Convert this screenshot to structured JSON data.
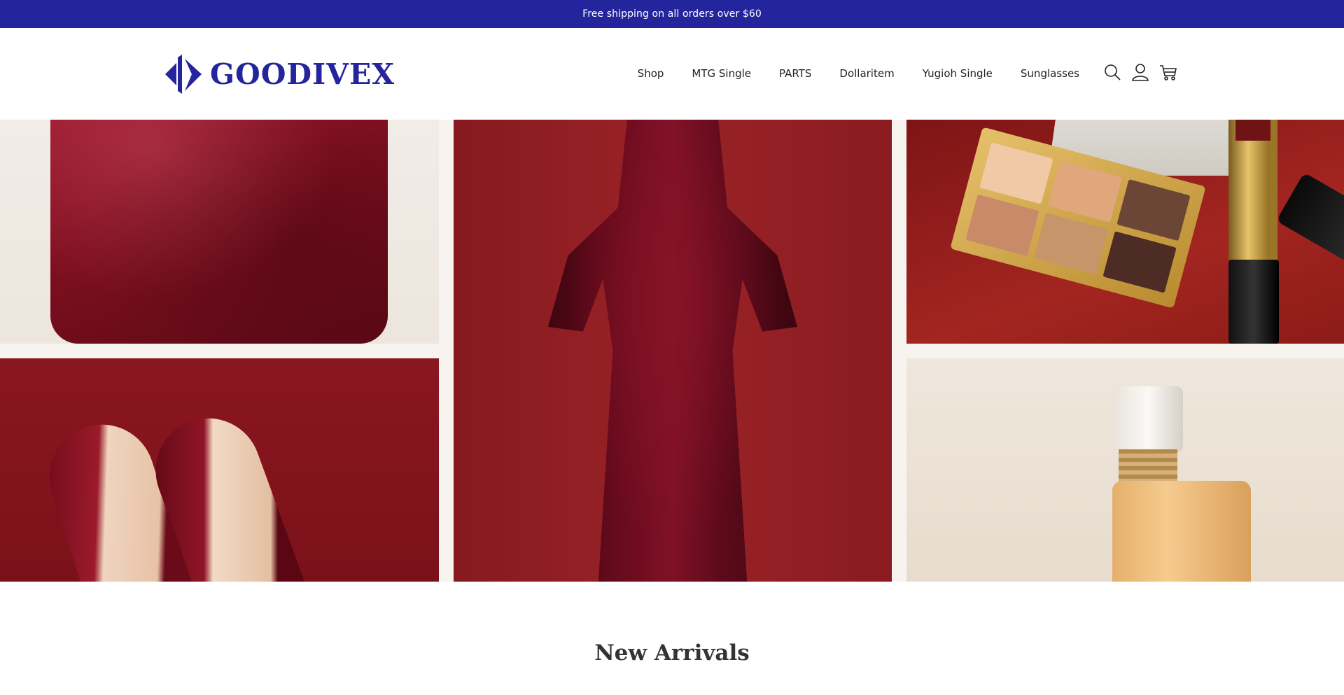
{
  "announcement": {
    "text": "Free shipping on all orders over $60"
  },
  "brand": {
    "name": "GOODIVEX",
    "color": "#24249c"
  },
  "nav": {
    "items": [
      {
        "label": "Shop"
      },
      {
        "label": "MTG Single"
      },
      {
        "label": "PARTS"
      },
      {
        "label": "Dollaritem"
      },
      {
        "label": "Yugioh Single"
      },
      {
        "label": "Sunglasses"
      }
    ]
  },
  "header_icons": [
    "search-icon",
    "account-icon",
    "cart-icon"
  ],
  "hero": {
    "images": [
      "velvet-handbag",
      "velvet-dress",
      "eyeshadow-palette-and-lipstick",
      "velvet-heels",
      "perfume-bottle"
    ]
  },
  "sections": {
    "new_arrivals_title": "New Arrivals"
  }
}
